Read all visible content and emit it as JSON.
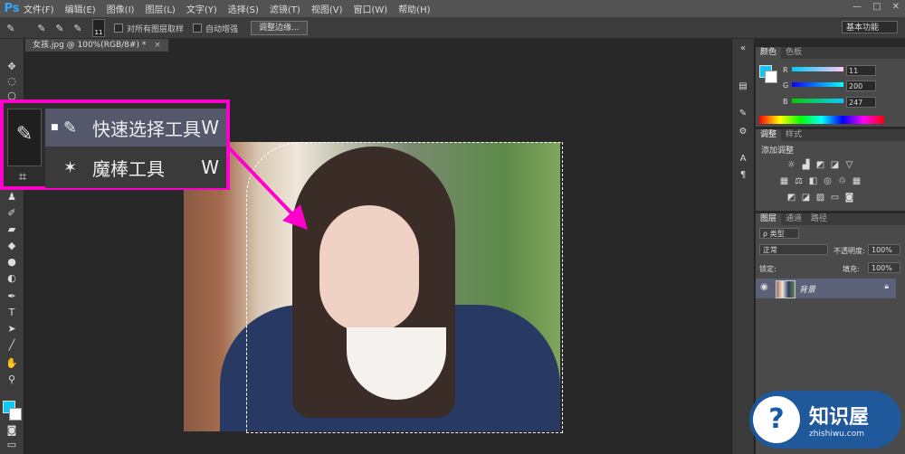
{
  "app": {
    "logo": "Ps",
    "menus": [
      "文件(F)",
      "编辑(E)",
      "图像(I)",
      "图层(L)",
      "文字(Y)",
      "选择(S)",
      "滤镜(T)",
      "视图(V)",
      "窗口(W)",
      "帮助(H)"
    ],
    "window_controls": [
      "—",
      "□",
      "✕"
    ]
  },
  "options_bar": {
    "brush_size": "11",
    "sample_all_layers": "对所有图层取样",
    "auto_enhance": "自动增强",
    "refine_edge": "调整边缘...",
    "workspace": "基本功能"
  },
  "document": {
    "tab_title": "女孩.jpg @ 100%(RGB/8#) *",
    "close": "×"
  },
  "tool_flyout": {
    "items": [
      {
        "label": "快速选择工具",
        "key": "W",
        "selected": true
      },
      {
        "label": "魔棒工具",
        "key": "W",
        "selected": false
      }
    ]
  },
  "color_panel": {
    "tabs": [
      "颜色",
      "色板"
    ],
    "channels": [
      {
        "name": "R",
        "value": "11"
      },
      {
        "name": "G",
        "value": "200"
      },
      {
        "name": "B",
        "value": "247"
      }
    ],
    "foreground": "#0bc8f7"
  },
  "adjust_panel": {
    "tabs": [
      "调整",
      "样式"
    ],
    "title": "添加调整"
  },
  "layers_panel": {
    "tabs": [
      "图层",
      "通道",
      "路径"
    ],
    "filter": "ρ 类型",
    "blend_mode": "正常",
    "opacity_label": "不透明度:",
    "opacity": "100%",
    "lock_label": "锁定:",
    "fill_label": "填充:",
    "fill": "100%",
    "layer_name": "背景"
  },
  "watermark": {
    "title": "知识屋",
    "subtitle": "zhishiwu.com"
  }
}
